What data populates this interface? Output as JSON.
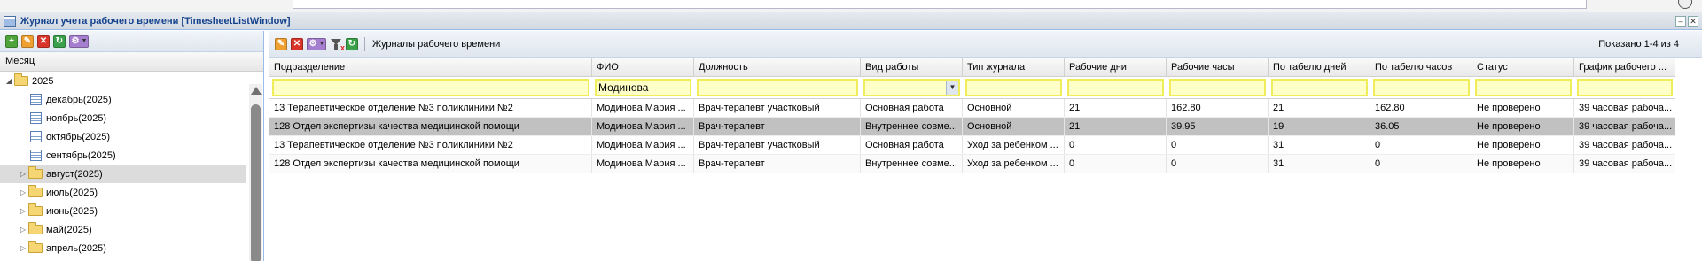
{
  "window": {
    "title": "Журнал учета рабочего времени [TimesheetListWindow]"
  },
  "left_panel": {
    "column_header": "Месяц",
    "toolbar_icons": [
      "add-icon",
      "edit-icon",
      "delete-icon",
      "refresh-icon",
      "settings-dropdown-icon"
    ],
    "tree": {
      "year": "2025",
      "months": [
        {
          "label": "декабрь(2025)",
          "type": "document"
        },
        {
          "label": "ноябрь(2025)",
          "type": "document"
        },
        {
          "label": "октябрь(2025)",
          "type": "document"
        },
        {
          "label": "сентябрь(2025)",
          "type": "document"
        },
        {
          "label": "август(2025)",
          "type": "folder",
          "selected": true
        },
        {
          "label": "июль(2025)",
          "type": "folder"
        },
        {
          "label": "июнь(2025)",
          "type": "folder"
        },
        {
          "label": "май(2025)",
          "type": "folder"
        },
        {
          "label": "апрель(2025)",
          "type": "folder"
        }
      ]
    }
  },
  "right_panel": {
    "toolbar_label": "Журналы рабочего времени",
    "paging": "Показано 1-4 из 4",
    "columns": [
      "Подразделение",
      "ФИО",
      "Должность",
      "Вид работы",
      "Тип журнала",
      "Рабочие дни",
      "Рабочие часы",
      "По табелю дней",
      "По табелю часов",
      "Статус",
      "График рабочего ..."
    ],
    "filters": [
      "",
      "Модинова",
      "",
      "",
      "",
      "",
      "",
      "",
      "",
      "",
      ""
    ],
    "rows": [
      [
        "13 Терапевтическое отделение №3 поликлиники №2",
        "Модинова Мария ...",
        "Врач-терапевт участковый",
        "Основная работа",
        "Основной",
        "21",
        "162.80",
        "21",
        "162.80",
        "Не проверено",
        "39 часовая рабоча..."
      ],
      [
        "128 Отдел экспертизы качества медицинской помощи",
        "Модинова Мария ...",
        "Врач-терапевт",
        "Внутреннее совме...",
        "Основной",
        "21",
        "39.95",
        "19",
        "36.05",
        "Не проверено",
        "39 часовая рабоча..."
      ],
      [
        "13 Терапевтическое отделение №3 поликлиники №2",
        "Модинова Мария ...",
        "Врач-терапевт участковый",
        "Основная работа",
        "Уход за ребенком ...",
        "0",
        "0",
        "31",
        "0",
        "Не проверено",
        "39 часовая рабоча..."
      ],
      [
        "128 Отдел экспертизы качества медицинской помощи",
        "Модинова Мария ...",
        "Врач-терапевт",
        "Внутреннее совме...",
        "Уход за ребенком ...",
        "0",
        "0",
        "31",
        "0",
        "Не проверено",
        "39 часовая рабоча..."
      ]
    ],
    "selected_row": 1
  },
  "colors": {
    "title_text": "#15428b",
    "filter_bg": "#ffffc8",
    "filter_border": "#f0ed5a",
    "selected_row": "#c1c1c1"
  }
}
